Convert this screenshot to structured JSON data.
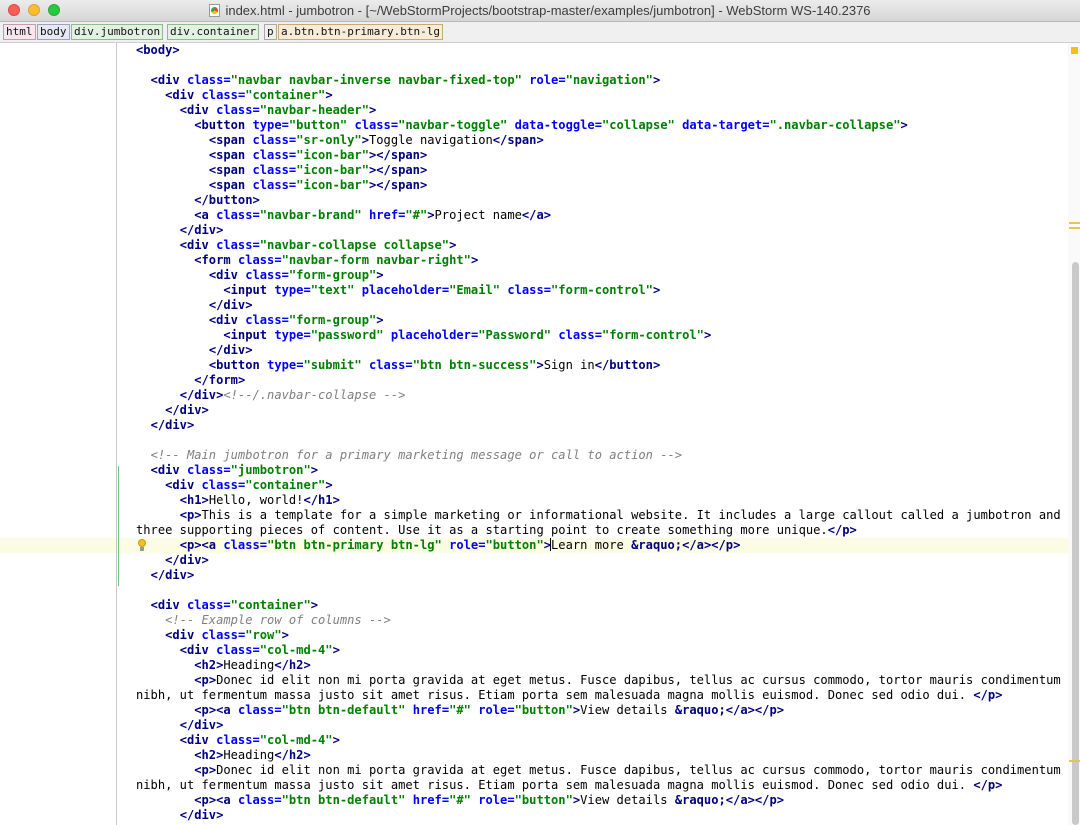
{
  "window": {
    "title": "index.html - jumbotron - [~/WebStormProjects/bootstrap-master/examples/jumbotron] - WebStorm WS-140.2376"
  },
  "breadcrumbs": [
    "html",
    "body",
    "div.jumbotron",
    "div.container",
    "p",
    "a.btn.btn-primary.btn-lg"
  ],
  "icons": {
    "file": "html-file-icon",
    "intention": "lightbulb-icon"
  },
  "editor": {
    "current_line": 33,
    "lines": [
      "<body>",
      "",
      "  <div class=\"navbar navbar-inverse navbar-fixed-top\" role=\"navigation\">",
      "    <div class=\"container\">",
      "      <div class=\"navbar-header\">",
      "        <button type=\"button\" class=\"navbar-toggle\" data-toggle=\"collapse\" data-target=\".navbar-collapse\">",
      "          <span class=\"sr-only\">Toggle navigation</span>",
      "          <span class=\"icon-bar\"></span>",
      "          <span class=\"icon-bar\"></span>",
      "          <span class=\"icon-bar\"></span>",
      "        </button>",
      "        <a class=\"navbar-brand\" href=\"#\">Project name</a>",
      "      </div>",
      "      <div class=\"navbar-collapse collapse\">",
      "        <form class=\"navbar-form navbar-right\">",
      "          <div class=\"form-group\">",
      "            <input type=\"text\" placeholder=\"Email\" class=\"form-control\">",
      "          </div>",
      "          <div class=\"form-group\">",
      "            <input type=\"password\" placeholder=\"Password\" class=\"form-control\">",
      "          </div>",
      "          <button type=\"submit\" class=\"btn btn-success\">Sign in</button>",
      "        </form>",
      "      </div><!--/.navbar-collapse -->",
      "    </div>",
      "  </div>",
      "",
      "  <!-- Main jumbotron for a primary marketing message or call to action -->",
      "  <div class=\"jumbotron\">",
      "    <div class=\"container\">",
      "      <h1>Hello, world!</h1>",
      "      <p>This is a template for a simple marketing or informational website. It includes a large callout called a jumbotron and",
      "three supporting pieces of content. Use it as a starting point to create something more unique.</p>",
      "      <p><a class=\"btn btn-primary btn-lg\" role=\"button\">Learn more &raquo;</a></p>",
      "    </div>",
      "  </div>",
      "",
      "  <div class=\"container\">",
      "    <!-- Example row of columns -->",
      "    <div class=\"row\">",
      "      <div class=\"col-md-4\">",
      "        <h2>Heading</h2>",
      "        <p>Donec id elit non mi porta gravida at eget metus. Fusce dapibus, tellus ac cursus commodo, tortor mauris condimentum",
      "nibh, ut fermentum massa justo sit amet risus. Etiam porta sem malesuada magna mollis euismod. Donec sed odio dui. </p>",
      "        <p><a class=\"btn btn-default\" href=\"#\" role=\"button\">View details &raquo;</a></p>",
      "      </div>",
      "      <div class=\"col-md-4\">",
      "        <h2>Heading</h2>",
      "        <p>Donec id elit non mi porta gravida at eget metus. Fusce dapibus, tellus ac cursus commodo, tortor mauris condimentum",
      "nibh, ut fermentum massa justo sit amet risus. Etiam porta sem malesuada magna mollis euismod. Donec sed odio dui. </p>",
      "        <p><a class=\"btn btn-default\" href=\"#\" role=\"button\">View details &raquo;</a></p>",
      "      </div>"
    ]
  }
}
